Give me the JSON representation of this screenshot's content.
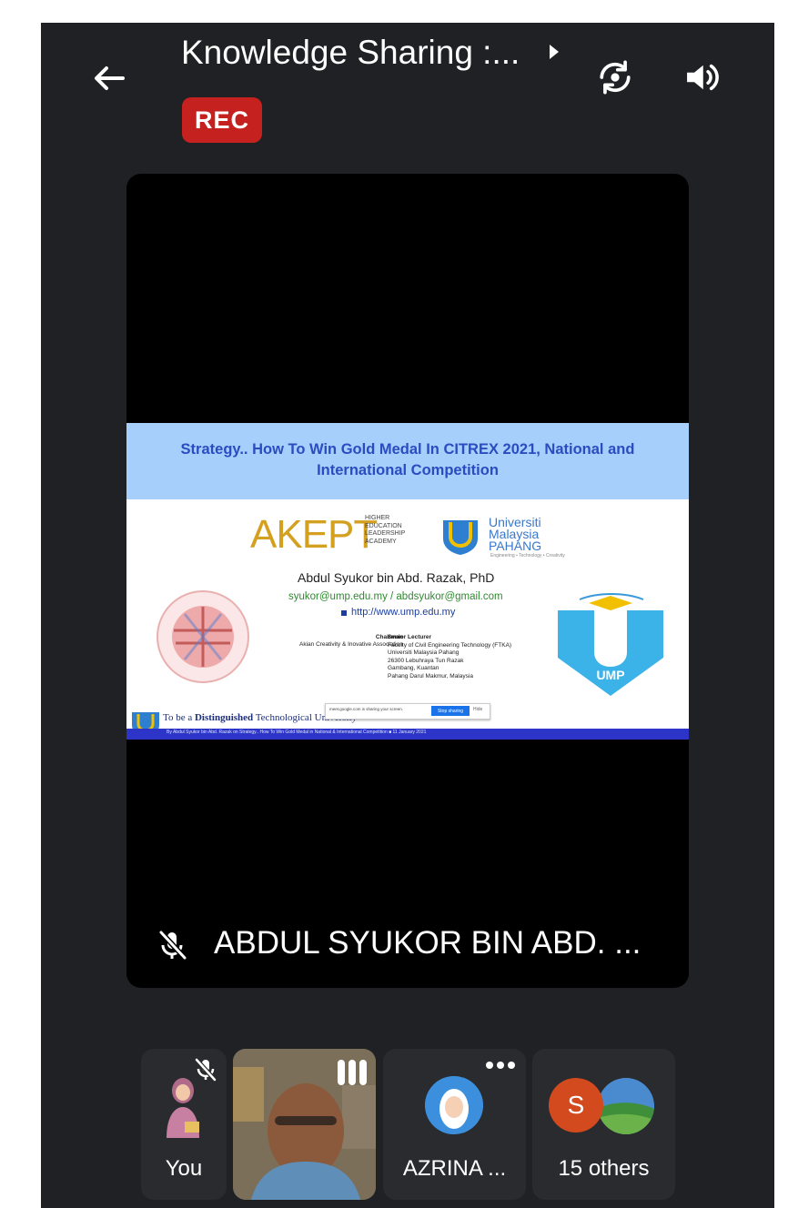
{
  "header": {
    "title": "Knowledge Sharing :...",
    "rec_badge": "REC"
  },
  "icons": {
    "back": "back-arrow-icon",
    "title_more": "caret-right-icon",
    "switch_camera": "switch-camera-icon",
    "speaker": "speaker-icon",
    "mic_off": "mic-off-icon",
    "more": "more-dots-icon",
    "audio_level": "audio-bars-icon"
  },
  "presentation": {
    "slide": {
      "title": "Strategy.. How To Win Gold Medal In CITREX 2021, National and International Competition",
      "akept_logo": "AKEPT",
      "akept_sub": "HIGHER\nEDUCATION\nLEADERSHIP\nACADEMY",
      "university": "Universiti\nMalaysia\nPAHANG",
      "university_tag": "Engineering • Technology • Creativity",
      "presenter": "Abdul Syukor bin Abd. Razak, PhD",
      "emails": "syukor@ump.edu.my / abdsyukor@gmail.com",
      "website": "http://www.ump.edu.my",
      "chairman_title": "Chairman",
      "chairman_org": "Akian Creativity & Inovative Association",
      "lecturer_title": "Senior Lecturer",
      "lecturer_lines": [
        "Faculty of Civil Engineering Technology (FTKA)",
        "Universiti Malaysia Pahang",
        "26300 Lebuhraya Tun Razak",
        "Gambang, Kuantan",
        "Pahang Darul Makmur, Malaysia"
      ],
      "ump_label": "UMP",
      "tagline_prefix": "To be a ",
      "tagline_bold": "Distinguished",
      "tagline_suffix": " Technological University",
      "sharing_notice": "meet.google.com is sharing your screen.",
      "stop_sharing": "Stop sharing",
      "hide": "Hide",
      "footer_text": "By Abdul Syukor bin Abd. Razak on Strategy.. How To Win Gold Medal in National & International Competition ■ 11 January 2021"
    },
    "speaker_name": "ABDUL SYUKOR BIN ABD. ..."
  },
  "participants": [
    {
      "label": "You"
    },
    {
      "label": ""
    },
    {
      "label": "AZRINA ..."
    },
    {
      "label": "15 others",
      "avatar_letter": "S"
    }
  ],
  "colors": {
    "background": "#202124",
    "rec": "#c5221f",
    "slide_header": "#a6cffb",
    "slide_title": "#2b4cc0"
  }
}
